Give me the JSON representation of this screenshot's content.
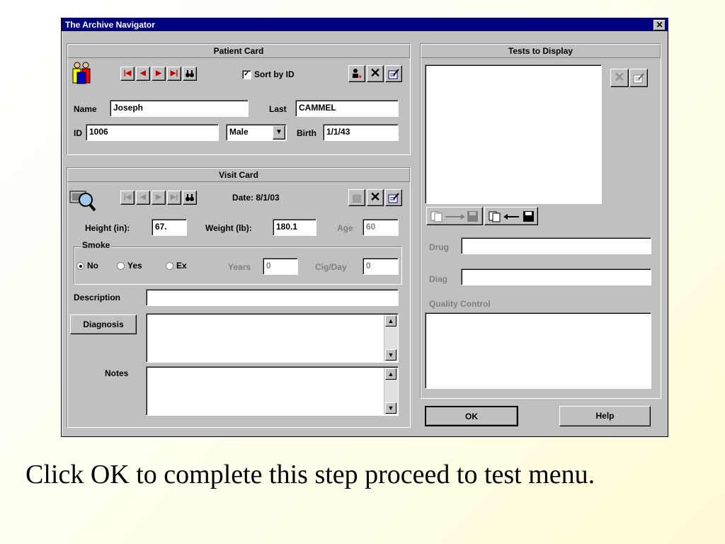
{
  "window": {
    "title": "The Archive Navigator",
    "close_label": "✕"
  },
  "patient_card": {
    "header": "Patient Card",
    "sort_label": "Sort by ID",
    "sort_checked": true,
    "name_label": "Name",
    "name_value": "Joseph",
    "last_label": "Last",
    "last_value": "CAMMEL",
    "id_label": "ID",
    "id_value": "1006",
    "sex_value": "Male",
    "birth_label": "Birth",
    "birth_value": "1/1/43"
  },
  "visit_card": {
    "header": "Visit Card",
    "date_text": "Date: 8/1/03",
    "height_label": "Height (in):",
    "height_value": "67.",
    "weight_label": "Weight (lb):",
    "weight_value": "180.1",
    "age_label": "Age",
    "age_value": "60",
    "smoke_label": "Smoke",
    "smoke_options": [
      "No",
      "Yes",
      "Ex"
    ],
    "smoke_selected": "No",
    "years_label": "Years",
    "years_value": "0",
    "cig_label": "Cig/Day",
    "cig_value": "0",
    "description_label": "Description",
    "description_value": "",
    "diagnosis_button": "Diagnosis",
    "notes_label": "Notes"
  },
  "tests": {
    "header": "Tests to Display",
    "drug_label": "Drug",
    "drug_value": "",
    "diag_label": "Diag",
    "diag_value": "",
    "qc_label": "Quality Control"
  },
  "buttons": {
    "ok": "OK",
    "help": "Help"
  },
  "caption": "Click OK to complete this  step proceed to test menu."
}
